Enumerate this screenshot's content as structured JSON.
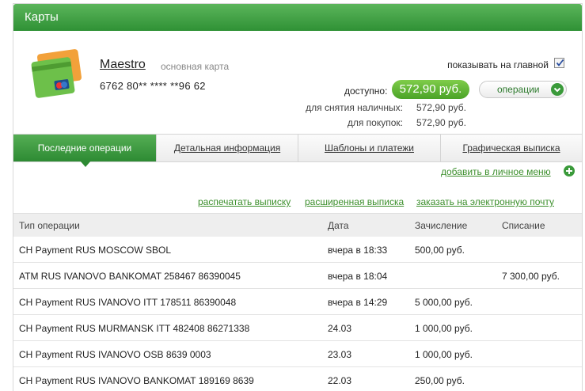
{
  "header": {
    "title": "Карты"
  },
  "card": {
    "name": "Maestro",
    "subtitle": "основная карта",
    "number": "6762 80** **** **96 62",
    "show_on_main_label": "показывать на главной",
    "show_on_main_checked": true,
    "available_label": "доступно:",
    "available_value": "572,90 руб.",
    "operations_button": "операции",
    "cash_label": "для снятия наличных:",
    "cash_value": "572,90 руб.",
    "purchase_label": "для покупок:",
    "purchase_value": "572,90 руб."
  },
  "tabs": [
    {
      "label": "Последние операции",
      "active": true
    },
    {
      "label": "Детальная информация",
      "active": false
    },
    {
      "label": "Шаблоны и платежи",
      "active": false
    },
    {
      "label": "Графическая выписка",
      "active": false
    }
  ],
  "links": {
    "add_to_menu": "добавить в личное меню",
    "print": "распечатать выписку",
    "extended": "расширенная выписка",
    "order_email": "заказать на электронную почту"
  },
  "table": {
    "headers": [
      "Тип операции",
      "Дата",
      "Зачисление",
      "Списание"
    ],
    "rows": [
      [
        "CH Payment RUS MOSCOW SBOL",
        "вчера в 18:33",
        "500,00 руб.",
        ""
      ],
      [
        "ATM RUS IVANOVO BANKOMAT 258467 86390045",
        "вчера в 18:04",
        "",
        "7 300,00 руб."
      ],
      [
        "CH Payment RUS IVANOVO ITT 178511 86390048",
        "вчера в 14:29",
        "5 000,00 руб.",
        ""
      ],
      [
        "CH Payment RUS MURMANSK ITT 482408 86271338",
        "24.03",
        "1 000,00 руб.",
        ""
      ],
      [
        "CH Payment RUS IVANOVO OSB 8639 0003",
        "23.03",
        "1 000,00 руб.",
        ""
      ],
      [
        "CH Payment RUS IVANOVO BANKOMAT 189169 8639",
        "22.03",
        "250,00 руб.",
        ""
      ]
    ]
  },
  "colors": {
    "brand_green": "#2f9135",
    "link_green": "#3c8f2c",
    "pill_green": "#5fb432"
  }
}
